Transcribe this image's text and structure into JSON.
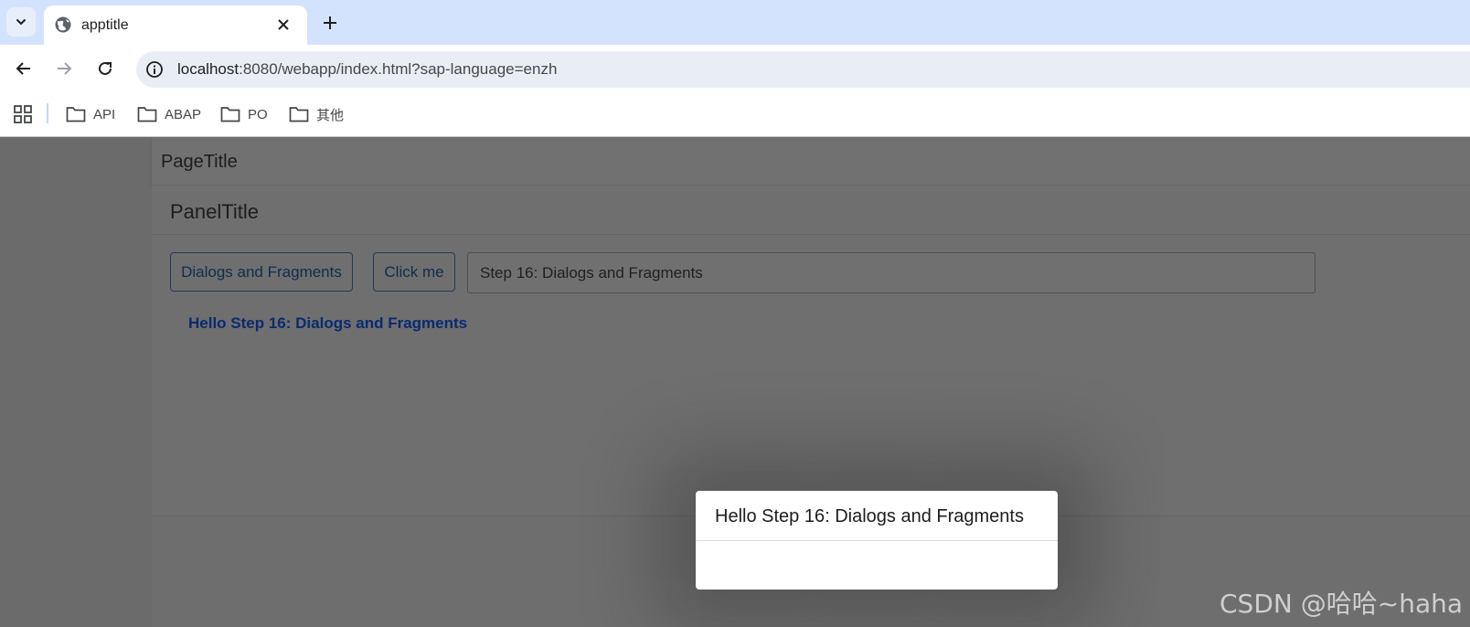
{
  "browser": {
    "tab": {
      "title": "apptitle",
      "favicon": "globe-icon"
    },
    "address": {
      "host": "localhost",
      "rest": ":8080/webapp/index.html?sap-language=enzh"
    },
    "bookmarks": [
      {
        "label": "API",
        "icon": "folder-icon"
      },
      {
        "label": "ABAP",
        "icon": "folder-icon"
      },
      {
        "label": "PO",
        "icon": "folder-icon"
      },
      {
        "label": "其他",
        "icon": "folder-icon"
      }
    ]
  },
  "page": {
    "title": "PageTitle",
    "panel": {
      "title": "PanelTitle",
      "dialog_button": "Dialogs and Fragments",
      "click_button": "Click me",
      "input_value": "Step 16: Dialogs and Fragments",
      "greeting": "Hello Step 16: Dialogs and Fragments"
    }
  },
  "dialog": {
    "title": "Hello Step 16: Dialogs and Fragments"
  },
  "watermark": "CSDN @哈哈~haha",
  "colors": {
    "tabstrip": "#d3e3fd",
    "omnibox": "#e9eef6",
    "overlay": "#6e6e6e",
    "greeting": "#0b2a6e"
  }
}
